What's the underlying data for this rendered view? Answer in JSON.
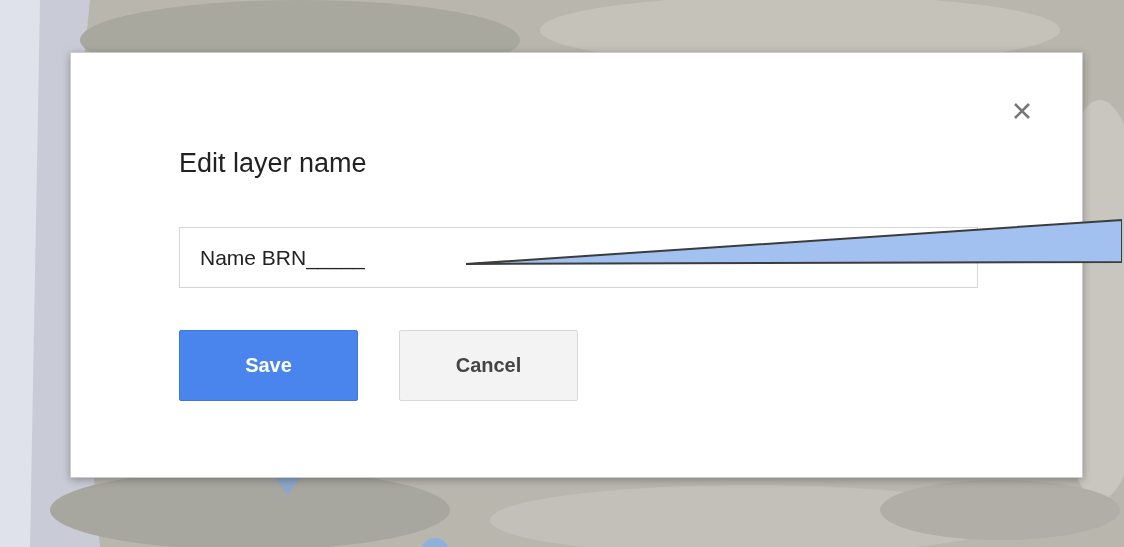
{
  "dialog": {
    "title": "Edit layer name",
    "name_field": {
      "value": "Name BRN_____"
    },
    "buttons": [
      {
        "label": "Save",
        "kind": "primary"
      },
      {
        "label": "Cancel",
        "kind": "secondary"
      }
    ]
  }
}
